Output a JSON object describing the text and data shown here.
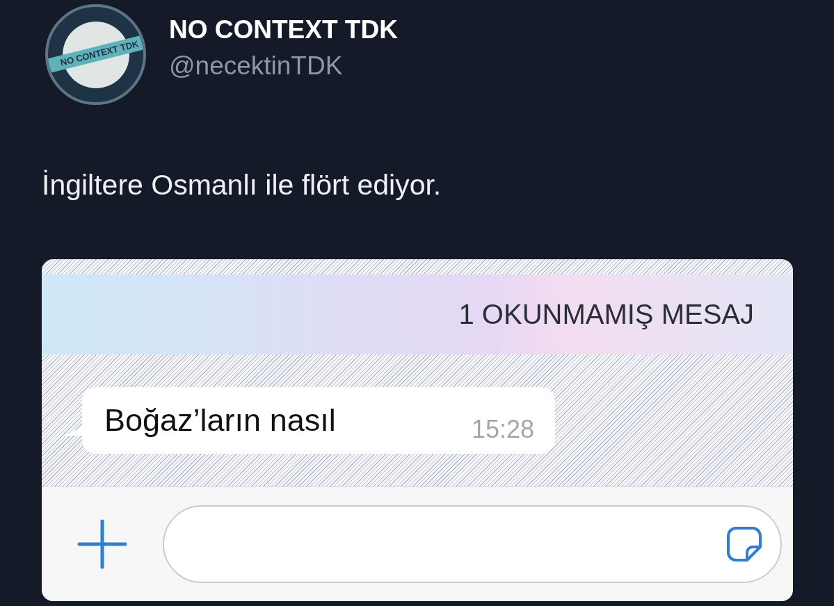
{
  "tweet": {
    "author": {
      "name": "NO CONTEXT TDK",
      "handle": "@necektinTDK",
      "avatar_label": "NO CONTEXT TDK"
    },
    "text": "İngiltere Osmanlı ile flört ediyor."
  },
  "chat": {
    "unread_banner": "1 OKUNMAMIŞ MESAJ",
    "messages": [
      {
        "text": "Boğaz’ların nasıl",
        "time": "15:28"
      }
    ]
  }
}
